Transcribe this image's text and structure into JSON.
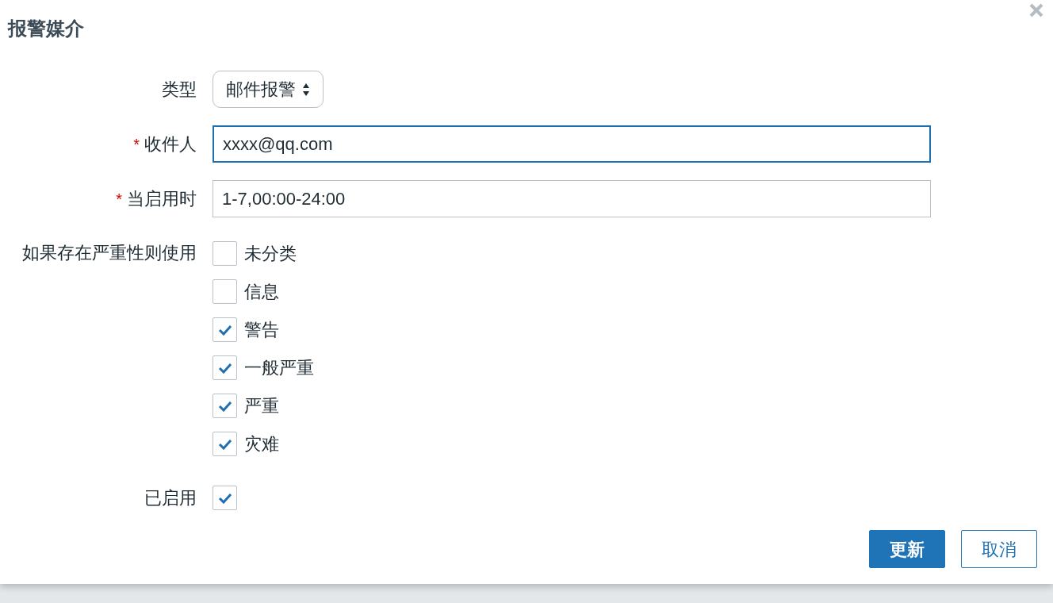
{
  "dialog": {
    "title": "报警媒介",
    "fields": [
      {
        "kind": "select",
        "label": "类型",
        "value": "邮件报警"
      },
      {
        "kind": "text",
        "label": "收件人",
        "required_mark": "*",
        "value": "xxxx@qq.com",
        "focused": true
      },
      {
        "kind": "text",
        "label": "当启用时",
        "required_mark": "*",
        "value": "1-7,00:00-24:00",
        "focused": false
      }
    ],
    "severity": {
      "label": "如果存在严重性则使用",
      "options": [
        {
          "label": "未分类",
          "checked": false
        },
        {
          "label": "信息",
          "checked": false
        },
        {
          "label": "警告",
          "checked": true
        },
        {
          "label": "一般严重",
          "checked": true
        },
        {
          "label": "严重",
          "checked": true
        },
        {
          "label": "灾难",
          "checked": true
        }
      ]
    },
    "enabled": {
      "label": "已启用",
      "checked": true
    },
    "buttons": [
      {
        "label": "更新",
        "kind": "primary"
      },
      {
        "label": "取消",
        "kind": "secondary"
      }
    ]
  }
}
